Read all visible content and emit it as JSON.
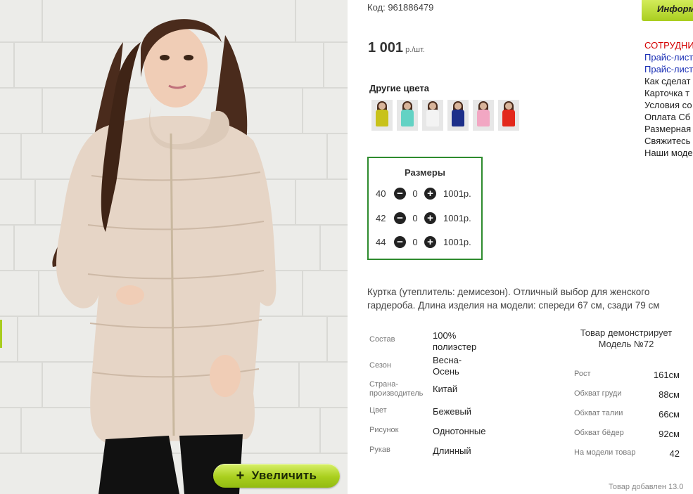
{
  "product": {
    "code": "Код: 961886479",
    "price": "1 001",
    "price_unit": "р./шт.",
    "zoom_label": "Увеличить",
    "zoom_plus": "+"
  },
  "other_colors": {
    "title": "Другие цвета",
    "swatches": [
      {
        "name": "yellow",
        "color": "#c8c21a"
      },
      {
        "name": "mint",
        "color": "#63d2c4"
      },
      {
        "name": "white",
        "color": "#f3f3f3"
      },
      {
        "name": "navy",
        "color": "#1d2f8a"
      },
      {
        "name": "pink",
        "color": "#f2a7c3"
      },
      {
        "name": "red",
        "color": "#e3281c"
      }
    ]
  },
  "sizes": {
    "title": "Размеры",
    "minus_icon": "minus-circle-icon",
    "plus_icon": "plus-circle-icon",
    "rows": [
      {
        "size": "40",
        "qty": "0",
        "price": "1001р."
      },
      {
        "size": "42",
        "qty": "0",
        "price": "1001р."
      },
      {
        "size": "44",
        "qty": "0",
        "price": "1001р."
      }
    ]
  },
  "description": "Куртка (утеплитель: демисезон). Отличный выбор для женского гардероба. Длина изделия на модели: спереди 67 см, сзади 79 см",
  "specs": [
    {
      "label": "Состав",
      "value": "100% полиэстер"
    },
    {
      "label": "Сезон",
      "value": "Весна-Осень"
    },
    {
      "label": "Страна-производитель",
      "value": "Китай"
    },
    {
      "label": "Цвет",
      "value": "Бежевый"
    },
    {
      "label": "Рисунок",
      "value": "Однотонные"
    },
    {
      "label": "Рукав",
      "value": "Длинный"
    }
  ],
  "model": {
    "title": "Товар демонстрирует Модель №72",
    "rows": [
      {
        "label": "Рост",
        "value": "161см"
      },
      {
        "label": "Обхват груди",
        "value": "88см"
      },
      {
        "label": "Обхват талии",
        "value": "66см"
      },
      {
        "label": "Обхват бёдер",
        "value": "92см"
      },
      {
        "label": "На модели товар",
        "value": "42"
      }
    ]
  },
  "added": "Товар добавлен 13.0",
  "right_column": {
    "info_button": "Информ",
    "links": [
      {
        "text": "СОТРУДНИ",
        "style": "red"
      },
      {
        "text": "Прайс-лист",
        "style": "blue"
      },
      {
        "text": "Прайс-лист",
        "style": "blue"
      },
      {
        "text": "Как сделат",
        "style": "plain"
      },
      {
        "text": "Карточка т",
        "style": "plain"
      },
      {
        "text": "Условия со",
        "style": "plain"
      },
      {
        "text": "Оплата Сб",
        "style": "plain"
      },
      {
        "text": "Размерная",
        "style": "plain"
      },
      {
        "text": "Свяжитесь",
        "style": "plain"
      },
      {
        "text": "Наши моде",
        "style": "plain"
      }
    ]
  },
  "colors": {
    "accent_green": "#2e8b2e",
    "button_green": "#a9cd1f",
    "jacket_beige": "#e6d5c6"
  }
}
